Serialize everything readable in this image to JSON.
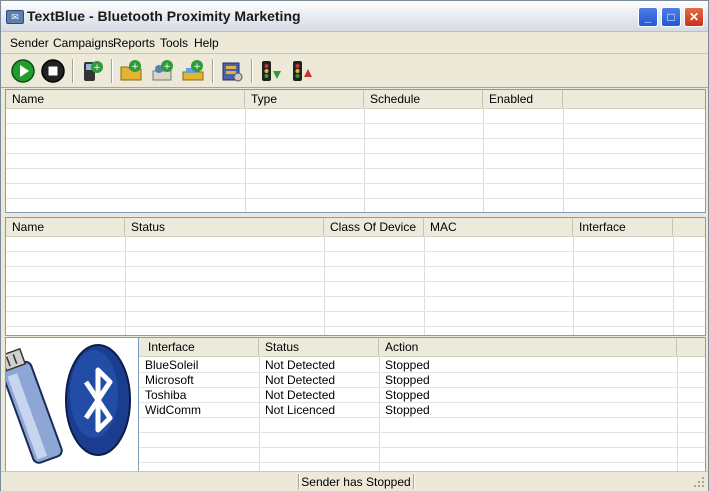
{
  "window": {
    "title": "TextBlue - Bluetooth Proximity Marketing"
  },
  "menu": [
    "Sender",
    "Campaigns",
    "Reports",
    "Tools",
    "Help"
  ],
  "campaigns_table": {
    "columns": [
      "Name",
      "Type",
      "Schedule",
      "Enabled"
    ],
    "rows": []
  },
  "devices_table": {
    "columns": [
      "Name",
      "Status",
      "Class Of Device",
      "MAC",
      "Interface"
    ],
    "rows": []
  },
  "interfaces_table": {
    "columns": [
      "Interface",
      "Status",
      "Action"
    ],
    "rows": [
      {
        "interface": "BlueSoleil",
        "status": "Not Detected",
        "action": "Stopped"
      },
      {
        "interface": "Microsoft",
        "status": "Not Detected",
        "action": "Stopped"
      },
      {
        "interface": "Toshiba",
        "status": "Not Detected",
        "action": "Stopped"
      },
      {
        "interface": "WidComm",
        "status": "Not Licenced",
        "action": "Stopped"
      }
    ]
  },
  "status_bar": {
    "message": "Sender has Stopped"
  },
  "colors": {
    "accent": "#2257d4",
    "close": "#c3331a",
    "bluetooth": "#1a3d8f",
    "play": "#1f9e2c"
  },
  "icons": [
    "play-icon",
    "stop-icon",
    "add-device-icon",
    "new-campaign-icon",
    "add-campaign-icon",
    "import-campaign-icon",
    "settings-icon",
    "move-down-icon",
    "move-up-icon",
    "bluetooth-logo-icon"
  ]
}
